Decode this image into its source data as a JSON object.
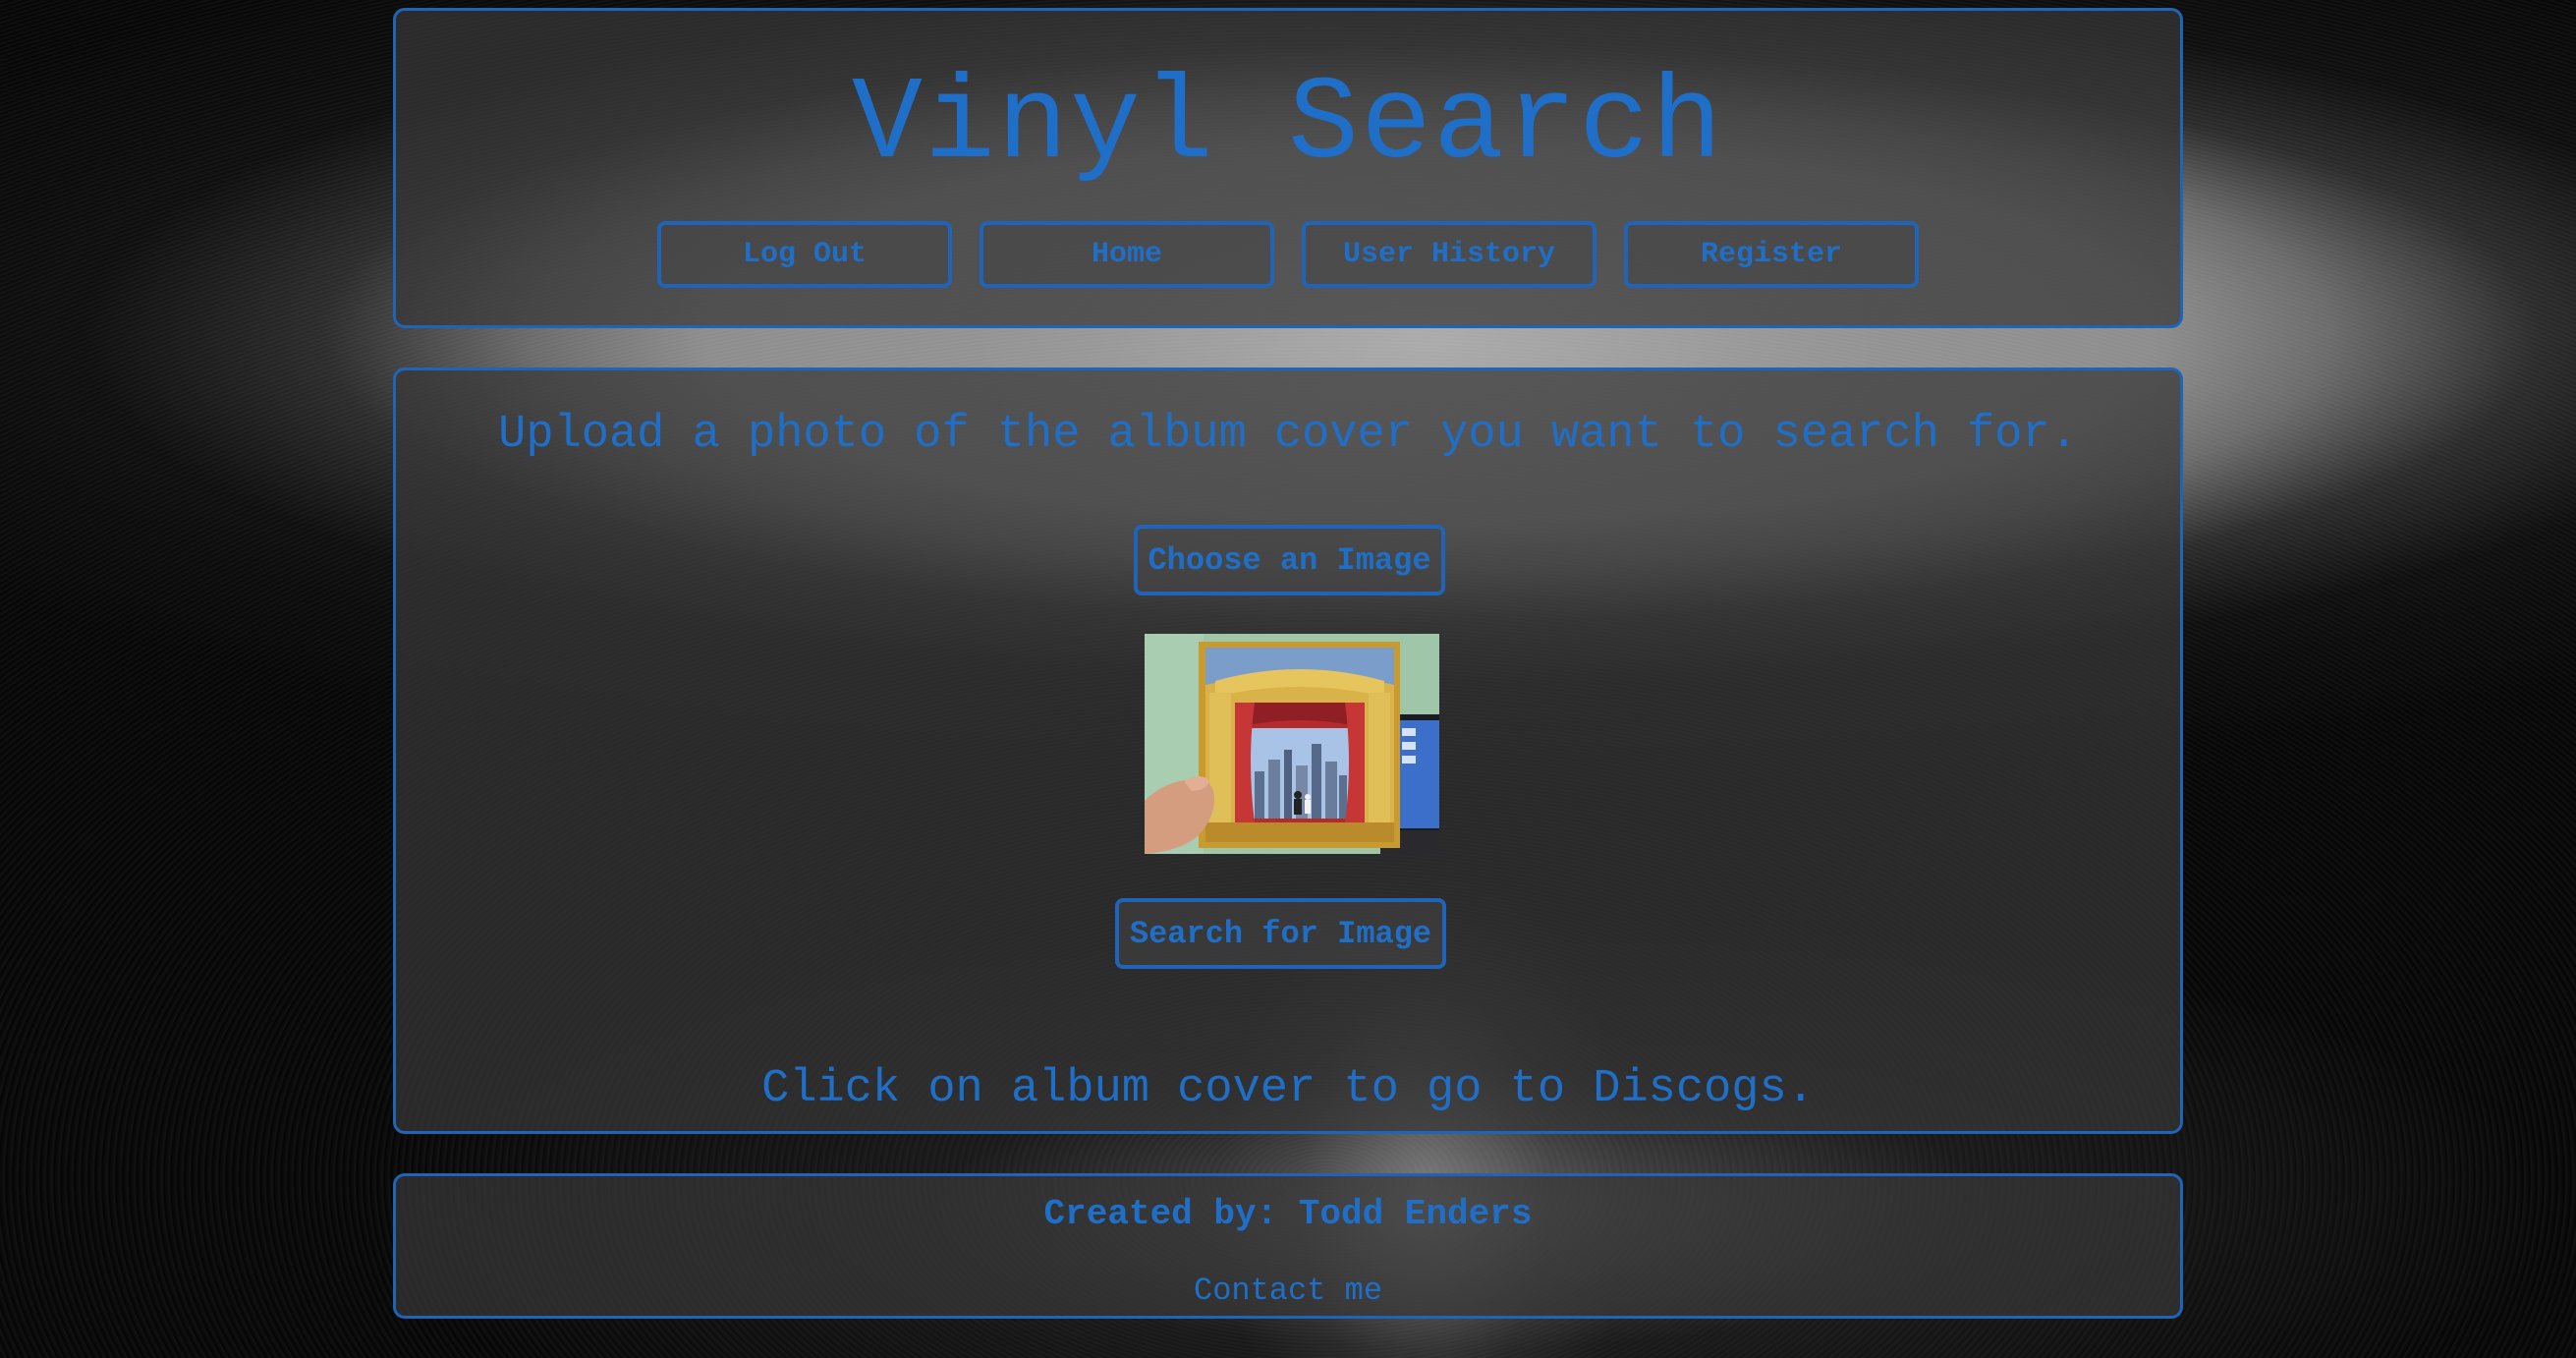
{
  "header": {
    "title": "Vinyl Search",
    "nav": [
      {
        "label": "Log Out"
      },
      {
        "label": "Home"
      },
      {
        "label": "User History"
      },
      {
        "label": "Register"
      }
    ]
  },
  "main": {
    "instructions": "Upload a photo of the album cover you want to search for.",
    "choose_label": "Choose an Image",
    "album_image": "album-cover-photo",
    "search_label": "Search for Image",
    "click_hint": "Click on album cover to go to Discogs."
  },
  "footer": {
    "credit": "Created by: Todd Enders",
    "contact": "Contact me"
  },
  "colors": {
    "accent": "#1f6fc8",
    "border": "#1f64b8",
    "panel": "#373737",
    "background": "#050505"
  }
}
